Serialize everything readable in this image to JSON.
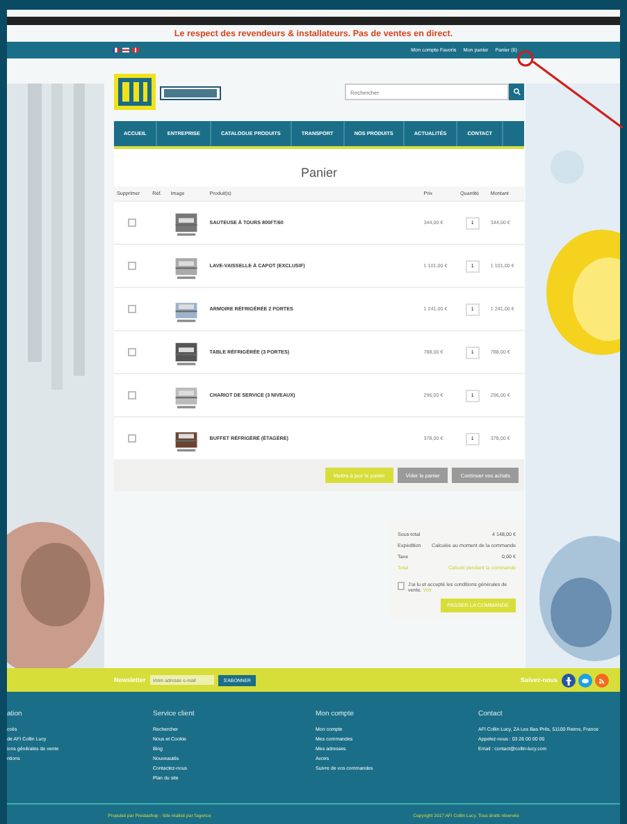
{
  "banner": "Le respect des revendeurs & installateurs. Pas de ventes en direct.",
  "top_links": [
    {
      "label": "Mon compte Favoris"
    },
    {
      "label": "Mon panier"
    },
    {
      "label": "Panier (6)"
    }
  ],
  "search": {
    "placeholder": "Rechercher"
  },
  "nav": [
    {
      "label": "ACCUEIL"
    },
    {
      "label": "ENTREPRISE"
    },
    {
      "label": "CATALOGUE PRODUITS"
    },
    {
      "label": "TRANSPORT"
    },
    {
      "label": "NOS PRODUITS"
    },
    {
      "label": "ACTUALITÉS"
    },
    {
      "label": "CONTACT"
    }
  ],
  "cart": {
    "title": "Panier",
    "columns": [
      "Supprimer",
      "Réf.",
      "Image",
      "Produit(s)",
      "Prix",
      "Quantité",
      "Montant"
    ],
    "rows": [
      {
        "checked": false,
        "name": "SAUTEUSE À TOURS 800FT/60",
        "price": "344,00 €",
        "quantity": "1",
        "amount": "344,00 €"
      },
      {
        "checked": false,
        "name": "LAVE-VAISSELLE À CAPOT (EXCLUSIF)",
        "price": "1 101,00 €",
        "quantity": "1",
        "amount": "1 101,00 €"
      },
      {
        "checked": false,
        "name": "ARMOIRE RÉFRIGÉRÉE 2 PORTES",
        "price": "1 241,00 €",
        "quantity": "1",
        "amount": "1 241,00 €"
      },
      {
        "checked": false,
        "name": "TABLE RÉFRIGÉRÉE (3 PORTES)",
        "price": "788,00 €",
        "quantity": "1",
        "amount": "788,00 €"
      },
      {
        "checked": false,
        "name": "CHARIOT DE SERVICE (3 NIVEAUX)",
        "price": "296,00 €",
        "quantity": "1",
        "amount": "296,00 €"
      },
      {
        "checked": false,
        "name": "BUFFET RÉFRIGÉRÉ (ÉTAGÈRE)",
        "price": "378,00 €",
        "quantity": "1",
        "amount": "378,00 €"
      }
    ]
  },
  "cart_actions": [
    {
      "label": "Mettre à jour le panier",
      "kind": "primary"
    },
    {
      "label": "Vider le panier",
      "kind": "secondary"
    },
    {
      "label": "Continuer vos achats",
      "kind": "secondary"
    }
  ],
  "totals": [
    {
      "label": "Sous-total",
      "value": "4 148,00 €",
      "kind": "normal"
    },
    {
      "label": "Expédition",
      "value": "Calculée au moment de la commande",
      "kind": "normal"
    },
    {
      "label": "Taxe",
      "value": "0,00 €",
      "kind": "normal"
    },
    {
      "label": "Total",
      "value": "Calculé pendant la commande",
      "kind": "highlight"
    }
  ],
  "terms": {
    "text": "J'ai lu et accepté les conditions générales de vente.",
    "link": "Voir",
    "checked": false
  },
  "checkout_button": "PASSER LA COMMANDE",
  "newsletter": {
    "label": "Newsletter",
    "placeholder": "Votre adresse e-mail",
    "button": "S'ABONNER"
  },
  "social": {
    "label": "Suivez-nous",
    "networks": [
      {
        "kind": "facebook",
        "color": "#2456a4"
      },
      {
        "kind": "twitter",
        "color": "#1ba1e2"
      },
      {
        "kind": "rss",
        "color": "#f26b1d"
      }
    ]
  },
  "footer_columns": [
    {
      "title": "ation",
      "links": [
        "ccès",
        "de AFI Collin Lucy",
        "ions générales de vente",
        "ntions"
      ]
    },
    {
      "title": "Service client",
      "links": [
        "Rechercher",
        "Nous et Cookie",
        "Blog",
        "Nouveautés",
        "Contactez-nous",
        "Plan du site"
      ]
    },
    {
      "title": "Mon compte",
      "links": [
        "Mon compte",
        "Mes commandes",
        "Mes adresses",
        "Avoirs",
        "Suivre de vos commandes"
      ]
    },
    {
      "title": "Contact",
      "links": [
        "AFI Collin Lucy, ZA Les Bas Prés, 51100 Reims, France",
        "Appelez-nous : 03 26 00 00 00",
        "Email : contact@collin-lucy.com"
      ]
    }
  ],
  "bottom_left": "Propulsé par Prestashop - Site réalisé par l'agence",
  "bottom_right": "Copyright 2017 AFI Collin Lucy. Tous droits réservés"
}
